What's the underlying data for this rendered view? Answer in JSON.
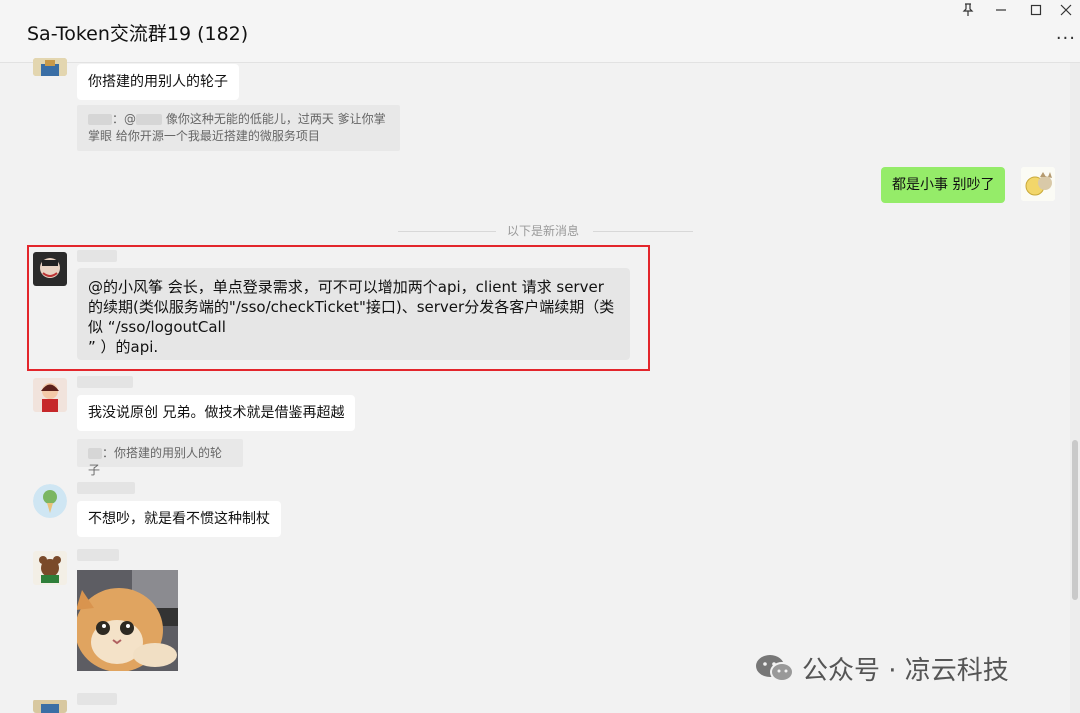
{
  "window": {
    "title": "Sa-Token交流群19 (182)",
    "controls": {
      "pin": "⊼",
      "minimize": "—",
      "maximize": "☐",
      "close": "✕"
    },
    "more": "···"
  },
  "messages": {
    "m1": {
      "text": "你搭建的用别人的轮子"
    },
    "q1": {
      "text": "像你这种无能的低能儿，过两天 爹让你掌掌眼 给你开源一个我最近搭建的微服务项目",
      "prefix": "：@"
    },
    "m2_self": {
      "text": "都是小事  别吵了"
    },
    "divider": "以下是新消息",
    "m3": {
      "text": "@的小风筝 会长，单点登录需求，可不可以增加两个api，client 请求 server 的续期(类似服务端的\"/sso/checkTicket\"接口)、server分发各客户端续期（类似 “/sso/logoutCall\n” ）的api."
    },
    "m4": {
      "text": "我没说原创 兄弟。做技术就是借鉴再超越"
    },
    "q2": {
      "text": "：你搭建的用别人的轮子"
    },
    "m5": {
      "text": "不想吵，就是看不惯这种制杖"
    }
  },
  "watermark": {
    "text": "公众号 · 凉云科技"
  },
  "colors": {
    "self_bubble": "#95ec69",
    "highlight": "#e3262c"
  }
}
